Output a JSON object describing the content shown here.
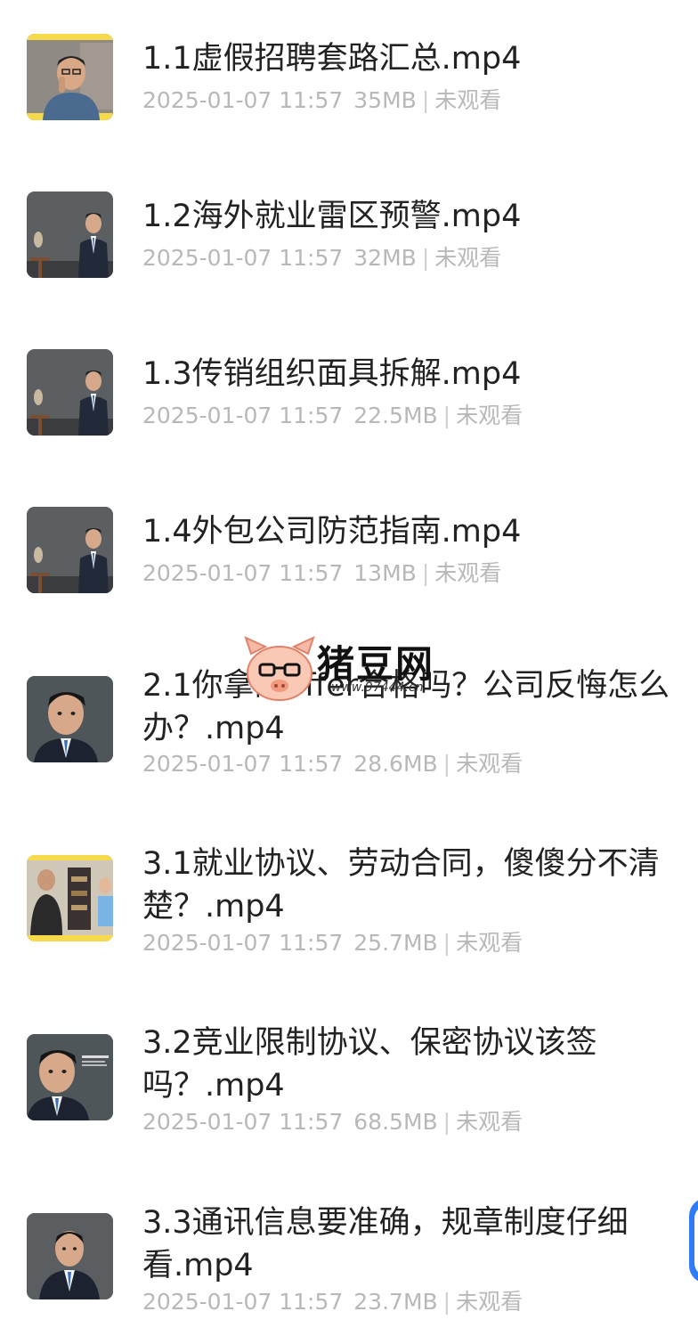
{
  "files": [
    {
      "title": "1.1虚假招聘套路汇总.mp4",
      "date": "2025-01-07 11:57",
      "size": "35MB",
      "status": "未观看",
      "thumb": "man-on-phone"
    },
    {
      "title": "1.2海外就业雷区预警.mp4",
      "date": "2025-01-07 11:57",
      "size": "32MB",
      "status": "未观看",
      "thumb": "man-in-suit-studio"
    },
    {
      "title": "1.3传销组织面具拆解.mp4",
      "date": "2025-01-07 11:57",
      "size": "22.5MB",
      "status": "未观看",
      "thumb": "man-in-suit-studio"
    },
    {
      "title": "1.4外包公司防范指南.mp4",
      "date": "2025-01-07 11:57",
      "size": "13MB",
      "status": "未观看",
      "thumb": "man-in-suit-studio"
    },
    {
      "title": "2.1你拿的offer合格吗？公司反悔怎么办？.mp4",
      "date": "2025-01-07 11:57",
      "size": "28.6MB",
      "status": "未观看",
      "thumb": "man-closeup"
    },
    {
      "title": "3.1就业协议、劳动合同，傻傻分不清楚？.mp4",
      "date": "2025-01-07 11:57",
      "size": "25.7MB",
      "status": "未观看",
      "thumb": "two-people-room"
    },
    {
      "title": "3.2竞业限制协议、保密协议该签吗？.mp4",
      "date": "2025-01-07 11:57",
      "size": "68.5MB",
      "status": "未观看",
      "thumb": "man-closeup"
    },
    {
      "title": "3.3通讯信息要准确，规章制度仔细看.mp4",
      "date": "2025-01-07 11:57",
      "size": "23.7MB",
      "status": "未观看",
      "thumb": "man-closeup"
    }
  ],
  "watermark": {
    "brand": "猪豆网",
    "url": "www.97444.cn",
    "icon": "pig-face-icon"
  },
  "floating_button": {
    "icon": "floating-edge-button",
    "color": "#2f7cf6"
  },
  "colors": {
    "title": "#222222",
    "meta": "#b8b8b8",
    "accent_yellow": "#f7d94c"
  }
}
